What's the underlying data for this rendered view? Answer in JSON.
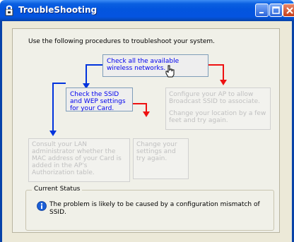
{
  "window": {
    "title": "TroubleShooting"
  },
  "intro_text": "Use the following procedures to troubleshoot your system.",
  "steps": {
    "check_networks": "Check all the available wireless networks.",
    "check_ssid": "Check the SSID and WEP settings for your Card.",
    "configure_ap": "Configure your AP to allow Broadcast SSID to associate.",
    "change_location": "Change your location by a few feet and try again.",
    "consult_admin": "Consult your LAN administrator whether the MAC address of your Card is added in the AP's Authorization table.",
    "change_settings": "Change your settings and try again."
  },
  "status": {
    "legend": "Current Status",
    "message": "The problem is likely to be caused by a configuration mismatch of SSID."
  },
  "colors": {
    "yes_arrow": "#0033dd",
    "no_arrow": "#ee1111",
    "title_bar": "#0355de"
  },
  "icons": [
    "app-icon",
    "minimize-icon",
    "maximize-icon",
    "close-icon",
    "hand-cursor-icon",
    "info-icon"
  ]
}
